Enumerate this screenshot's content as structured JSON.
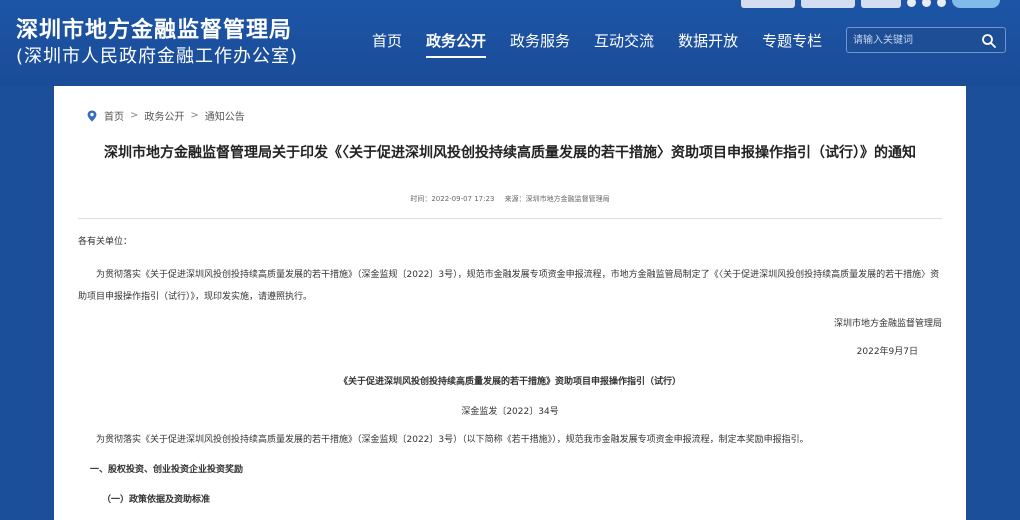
{
  "header": {
    "title": "深圳市地方金融监督管理局",
    "subtitle": "(深圳市人民政府金融工作办公室)",
    "nav": [
      {
        "label": "首页",
        "active": false
      },
      {
        "label": "政务公开",
        "active": true
      },
      {
        "label": "政务服务",
        "active": false
      },
      {
        "label": "互动交流",
        "active": false
      },
      {
        "label": "数据开放",
        "active": false
      },
      {
        "label": "专题专栏",
        "active": false
      }
    ],
    "search": {
      "placeholder": "请输入关键词"
    },
    "colors": {
      "header_bg": "#1b4f9a",
      "card_bg": "#ffffff"
    }
  },
  "breadcrumb": {
    "items": [
      "首页",
      "政务公开",
      "通知公告"
    ],
    "separator": ">"
  },
  "article": {
    "title": "深圳市地方金融监督管理局关于印发《〈关于促进深圳风投创投持续高质量发展的若干措施〉资助项目申报操作指引（试行）》的通知",
    "time_label": "时间：2022-09-07 17:23",
    "source_label": "来源：深圳市地方金融监督管理局",
    "salutation": "各有关单位：",
    "body1": "为贯彻落实《关于促进深圳风投创投持续高质量发展的若干措施》（深金监规〔2022〕3号），规范市金融发展专项资金申报流程，市地方金融监管局制定了《〈关于促进深圳风投创投持续高质量发展的若干措施〉资助项目申报操作指引（试行）》，现印发实施，请遵照执行。",
    "signature": "深圳市地方金融监督管理局",
    "date": "2022年9月7日",
    "sub_title": "《关于促进深圳风投创投持续高质量发展的若干措施》资助项目申报操作指引（试行）",
    "doc_number": "深金监发〔2022〕34号",
    "body2": "为贯彻落实《关于促进深圳风投创投持续高质量发展的若干措施》（深金监规〔2022〕3号）（以下简称《若干措施》），规范我市金融发展专项资金申报流程，制定本奖励申报指引。",
    "section1": "一、股权投资、创业投资企业投资奖励",
    "section2": "（一）政策依据及资助标准"
  }
}
